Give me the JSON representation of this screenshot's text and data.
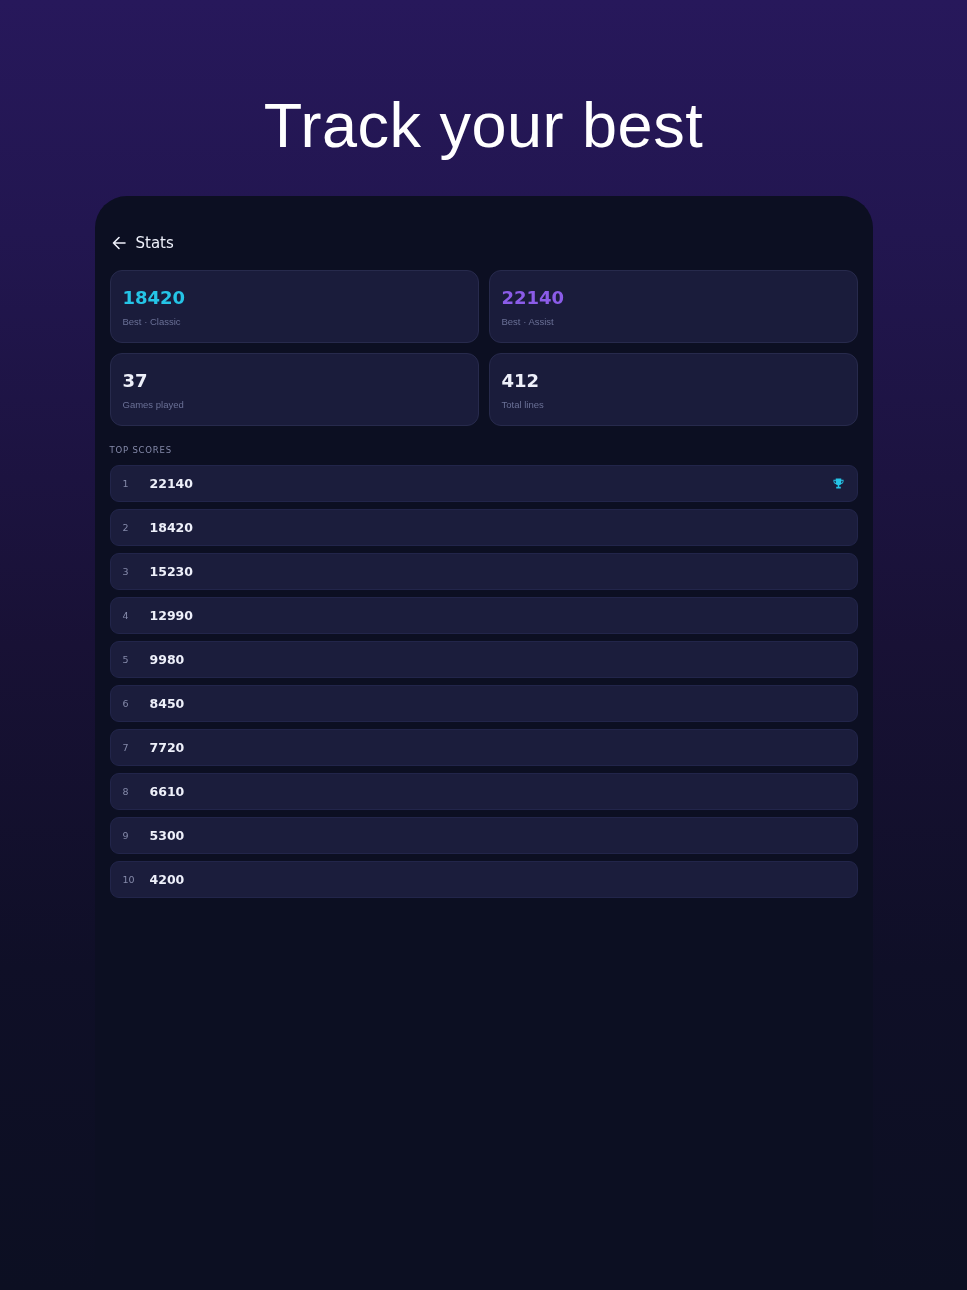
{
  "heading": "Track your best",
  "screen": {
    "title": "Stats",
    "stats": [
      {
        "value": "18420",
        "label": "Best · Classic",
        "color": "#25c4e6"
      },
      {
        "value": "22140",
        "label": "Best · Assist",
        "color": "#8b5ce8"
      },
      {
        "value": "37",
        "label": "Games played",
        "color": "#eef0fa"
      },
      {
        "value": "412",
        "label": "Total lines",
        "color": "#eef0fa"
      }
    ],
    "section_label": "TOP SCORES",
    "scores": [
      {
        "rank": "1",
        "score": "22140",
        "trophy": true
      },
      {
        "rank": "2",
        "score": "18420",
        "trophy": false
      },
      {
        "rank": "3",
        "score": "15230",
        "trophy": false
      },
      {
        "rank": "4",
        "score": "12990",
        "trophy": false
      },
      {
        "rank": "5",
        "score": "9980",
        "trophy": false
      },
      {
        "rank": "6",
        "score": "8450",
        "trophy": false
      },
      {
        "rank": "7",
        "score": "7720",
        "trophy": false
      },
      {
        "rank": "8",
        "score": "6610",
        "trophy": false
      },
      {
        "rank": "9",
        "score": "5300",
        "trophy": false
      },
      {
        "rank": "10",
        "score": "4200",
        "trophy": false
      }
    ]
  }
}
